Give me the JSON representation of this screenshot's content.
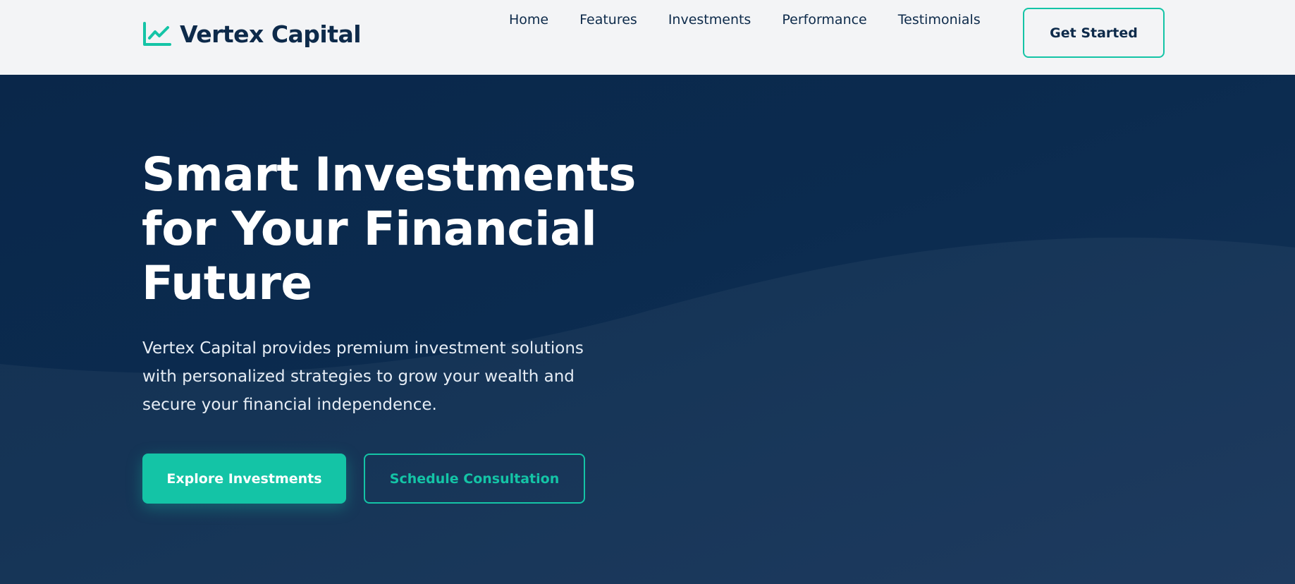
{
  "brand": {
    "name": "Vertex Capital",
    "logo_icon": "chart-line-icon",
    "accent_color": "#14c4a6",
    "dark_color": "#0d2a4a"
  },
  "nav": {
    "items": [
      {
        "label": "Home"
      },
      {
        "label": "Features"
      },
      {
        "label": "Investments"
      },
      {
        "label": "Performance"
      },
      {
        "label": "Testimonials"
      }
    ],
    "cta_label": "Get Started"
  },
  "hero": {
    "title": "Smart Investments for Your Financial Future",
    "description": "Vertex Capital provides premium investment solutions with personalized strategies to grow your wealth and secure your financial independence.",
    "primary_button": "Explore Investments",
    "secondary_button": "Schedule Consultation",
    "background_color": "#0b2a4a"
  }
}
